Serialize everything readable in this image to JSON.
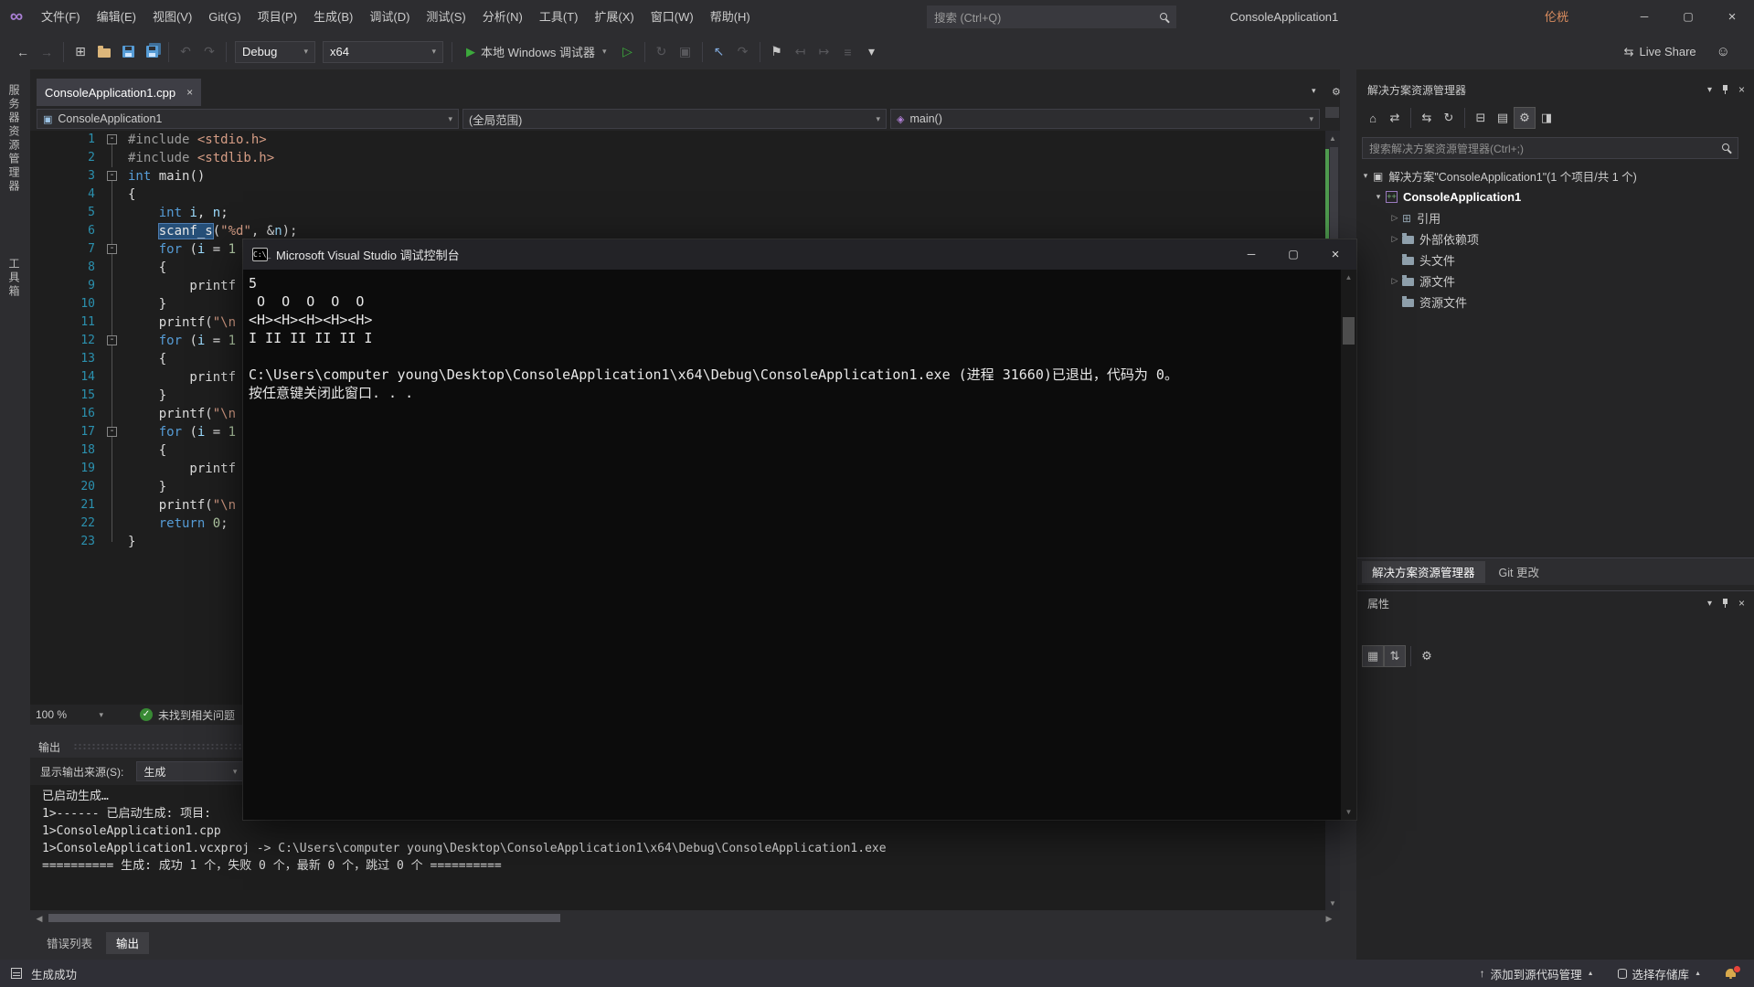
{
  "colors": {
    "keyword": "#569CD6",
    "string": "#D69D85",
    "number": "#B5CEA8",
    "identifier": "#9CDCFE",
    "line_number": "#2B91AF",
    "change_bar_saved": "#4E9A4E",
    "run_green": "#3CA93C",
    "highlight_bg": "#264F78"
  },
  "title_bar": {
    "menus": [
      "文件(F)",
      "编辑(E)",
      "视图(V)",
      "Git(G)",
      "项目(P)",
      "生成(B)",
      "调试(D)",
      "测试(S)",
      "分析(N)",
      "工具(T)",
      "扩展(X)",
      "窗口(W)",
      "帮助(H)"
    ],
    "search_placeholder": "搜索 (Ctrl+Q)",
    "window_title": "ConsoleApplication1",
    "user_name": "伦桄"
  },
  "toolbar": {
    "config": "Debug",
    "platform": "x64",
    "debug_target": "本地 Windows 调试器",
    "live_share": "Live Share",
    "left_icons": [
      {
        "name": "navigate-back-icon",
        "glyph": "back"
      },
      {
        "name": "navigate-forward-icon",
        "glyph": "fwd",
        "disabled": true
      },
      "sep",
      {
        "name": "new-project-icon",
        "glyph": "newproj"
      },
      {
        "name": "open-file-icon",
        "glyph": "folder"
      },
      {
        "name": "save-icon",
        "glyph": "floppy"
      },
      {
        "name": "save-all-icon",
        "glyph": "floppy2"
      },
      "sep",
      {
        "name": "undo-icon",
        "glyph": "undo",
        "disabled": true
      },
      {
        "name": "redo-icon",
        "glyph": "redo",
        "disabled": true
      },
      "sep"
    ],
    "run_icons": [
      {
        "name": "start-without-debugging-icon",
        "glyph": "playo",
        "color": "green"
      },
      "sep",
      {
        "name": "hot-reload-icon",
        "glyph": "refresh",
        "disabled": true
      },
      {
        "name": "debug-windows-icon",
        "glyph": "box",
        "disabled": true
      },
      "sep",
      {
        "name": "pointer-mode-icon",
        "glyph": "pointer",
        "color": "blue"
      },
      {
        "name": "step-over-icon",
        "glyph": "redo",
        "disabled": true
      },
      "sep",
      {
        "name": "bookmark-icon",
        "glyph": "flag"
      },
      {
        "name": "prev-bookmark-icon",
        "glyph": "lmap",
        "disabled": true
      },
      {
        "name": "next-bookmark-icon",
        "glyph": "rmap",
        "disabled": true
      },
      {
        "name": "comment-icon",
        "glyph": "lines",
        "disabled": true
      },
      {
        "name": "toolbar-overflow-icon",
        "glyph": "chevd"
      }
    ]
  },
  "left_strip": {
    "tabs": [
      "服务器资源管理器",
      "工具箱"
    ]
  },
  "editor": {
    "tab_title": "ConsoleApplication1.cpp",
    "nav": {
      "project": "ConsoleApplication1",
      "scope": "(全局范围)",
      "member": "main()"
    },
    "zoom": "100 %",
    "health": "未找到相关问题",
    "code_lines": [
      {
        "n": 1,
        "fold": true,
        "t": [
          [
            "pp",
            "#include "
          ],
          [
            "str",
            "<stdio.h>"
          ]
        ]
      },
      {
        "n": 2,
        "t": [
          [
            "pp",
            "#include "
          ],
          [
            "str",
            "<stdlib.h>"
          ]
        ]
      },
      {
        "n": 3,
        "fold": true,
        "t": [
          [
            "kw",
            "int"
          ],
          [
            "pl",
            " main()"
          ]
        ]
      },
      {
        "n": 4,
        "t": [
          [
            "pl",
            "{"
          ]
        ]
      },
      {
        "n": 5,
        "t": [
          [
            "pl",
            "    "
          ],
          [
            "kw",
            "int"
          ],
          [
            "pl",
            " "
          ],
          [
            "id",
            "i"
          ],
          [
            "pl",
            ", "
          ],
          [
            "id",
            "n"
          ],
          [
            "pl",
            ";"
          ]
        ]
      },
      {
        "n": 6,
        "t": [
          [
            "pl",
            "    "
          ],
          [
            "hl",
            "scanf_s"
          ],
          [
            "pl",
            "("
          ],
          [
            "str",
            "\"%d\""
          ],
          [
            "pl",
            ", &"
          ],
          [
            "id",
            "n"
          ],
          [
            "pl",
            ");"
          ]
        ]
      },
      {
        "n": 7,
        "fold": true,
        "t": [
          [
            "pl",
            "    "
          ],
          [
            "kw",
            "for"
          ],
          [
            "pl",
            " ("
          ],
          [
            "id",
            "i"
          ],
          [
            "pl",
            " = "
          ],
          [
            "num",
            "1"
          ]
        ]
      },
      {
        "n": 8,
        "t": [
          [
            "pl",
            "    {"
          ]
        ]
      },
      {
        "n": 9,
        "t": [
          [
            "pl",
            "        printf"
          ]
        ]
      },
      {
        "n": 10,
        "t": [
          [
            "pl",
            "    }"
          ]
        ]
      },
      {
        "n": 11,
        "t": [
          [
            "pl",
            "    printf("
          ],
          [
            "str",
            "\"\\n"
          ]
        ]
      },
      {
        "n": 12,
        "fold": true,
        "t": [
          [
            "pl",
            "    "
          ],
          [
            "kw",
            "for"
          ],
          [
            "pl",
            " ("
          ],
          [
            "id",
            "i"
          ],
          [
            "pl",
            " = "
          ],
          [
            "num",
            "1"
          ]
        ]
      },
      {
        "n": 13,
        "t": [
          [
            "pl",
            "    {"
          ]
        ]
      },
      {
        "n": 14,
        "t": [
          [
            "pl",
            "        printf"
          ]
        ]
      },
      {
        "n": 15,
        "t": [
          [
            "pl",
            "    }"
          ]
        ]
      },
      {
        "n": 16,
        "t": [
          [
            "pl",
            "    printf("
          ],
          [
            "str",
            "\"\\n"
          ]
        ]
      },
      {
        "n": 17,
        "fold": true,
        "t": [
          [
            "pl",
            "    "
          ],
          [
            "kw",
            "for"
          ],
          [
            "pl",
            " ("
          ],
          [
            "id",
            "i"
          ],
          [
            "pl",
            " = "
          ],
          [
            "num",
            "1"
          ]
        ]
      },
      {
        "n": 18,
        "t": [
          [
            "pl",
            "    {"
          ]
        ]
      },
      {
        "n": 19,
        "t": [
          [
            "pl",
            "        printf"
          ]
        ]
      },
      {
        "n": 20,
        "t": [
          [
            "pl",
            "    }"
          ]
        ]
      },
      {
        "n": 21,
        "t": [
          [
            "pl",
            "    printf("
          ],
          [
            "str",
            "\"\\n"
          ]
        ]
      },
      {
        "n": 22,
        "t": [
          [
            "pl",
            "    "
          ],
          [
            "kw",
            "return"
          ],
          [
            "pl",
            " "
          ],
          [
            "num",
            "0"
          ],
          [
            "pl",
            ";"
          ]
        ]
      },
      {
        "n": 23,
        "t": [
          [
            "pl",
            "}"
          ]
        ]
      }
    ]
  },
  "console_window": {
    "title": "Microsoft Visual Studio 调试控制台",
    "lines": [
      "5",
      " O  O  O  O  O",
      "<H><H><H><H><H>",
      "I II II II II I",
      "",
      "C:\\Users\\computer young\\Desktop\\ConsoleApplication1\\x64\\Debug\\ConsoleApplication1.exe (进程 31660)已退出，代码为 0。",
      "按任意键关闭此窗口. . ."
    ]
  },
  "output_panel": {
    "title": "输出",
    "source_label": "显示输出来源(S):",
    "source_value": "生成",
    "lines": [
      "已启动生成…",
      "1>------ 已启动生成: 项目: ",
      "1>ConsoleApplication1.cpp",
      "1>ConsoleApplication1.vcxproj -> C:\\Users\\computer young\\Desktop\\ConsoleApplication1\\x64\\Debug\\ConsoleApplication1.exe",
      "========== 生成: 成功 1 个，失败 0 个，最新 0 个，跳过 0 个 =========="
    ],
    "tabs": [
      "错误列表",
      "输出"
    ]
  },
  "solution_explorer": {
    "title": "解决方案资源管理器",
    "search_placeholder": "搜索解决方案资源管理器(Ctrl+;)",
    "toolbar_icons": [
      {
        "name": "home-icon",
        "glyph": "home"
      },
      {
        "name": "switch-views-icon",
        "glyph": "swap"
      },
      "sep",
      {
        "name": "sync-with-active-document-icon",
        "glyph": "sync"
      },
      {
        "name": "refresh-icon",
        "glyph": "refresh"
      },
      "sep",
      {
        "name": "collapse-all-icon",
        "glyph": "collapse"
      },
      {
        "name": "show-all-files-icon",
        "glyph": "allfiles"
      },
      {
        "name": "properties-icon",
        "glyph": "gear",
        "active": true
      },
      {
        "name": "preview-selected-icon",
        "glyph": "preview"
      }
    ],
    "tree": [
      {
        "label": "解决方案\"ConsoleApplication1\"(1 个项目/共 1 个)"
      },
      {
        "label": "ConsoleApplication1"
      },
      {
        "label": "引用"
      },
      {
        "label": "外部依赖项"
      },
      {
        "label": "头文件"
      },
      {
        "label": "源文件"
      },
      {
        "label": "资源文件"
      }
    ],
    "tabs": [
      "解决方案资源管理器",
      "Git 更改"
    ]
  },
  "properties_panel": {
    "title": "属性",
    "toolbar_icons": [
      {
        "name": "categorized-icon",
        "glyph": "cat",
        "active": true
      },
      {
        "name": "alphabetical-icon",
        "glyph": "alpha",
        "active": true
      },
      "sep",
      {
        "name": "property-pages-icon",
        "glyph": "gear"
      }
    ]
  },
  "status_bar": {
    "left": "生成成功",
    "add_source_control": "添加到源代码管理",
    "select_repo": "选择存储库"
  }
}
